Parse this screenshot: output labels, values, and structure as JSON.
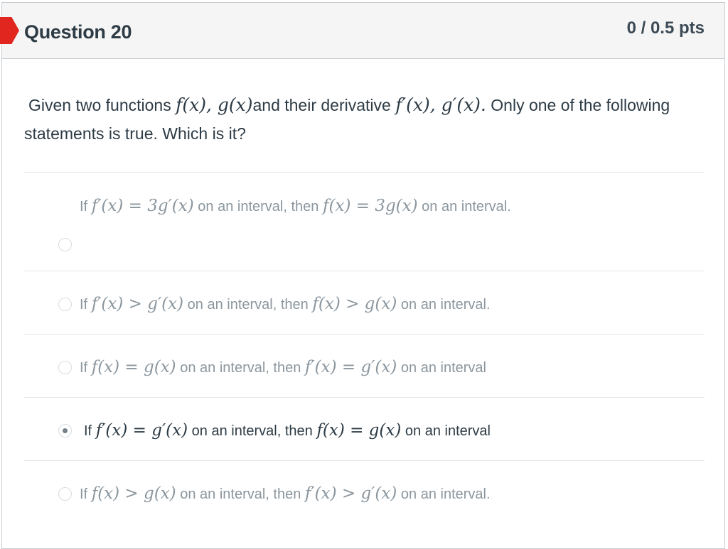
{
  "question": {
    "title": "Question 20",
    "points": "0 / 0.5 pts",
    "text_lead": "Given two functions",
    "text_math1": "f(x), g(x)",
    "text_mid": "and their derivative",
    "text_math2": "f′(x), g′(x).",
    "text_tail": "Only one of the following statements is true. Which is it?"
  },
  "answers": [
    {
      "if": "If",
      "m1": "f′(x) = 3g′(x)",
      "mid": "on an interval, then",
      "m2": "f(x) = 3g(x)",
      "end": "on an interval.",
      "selected": false
    },
    {
      "if": "If",
      "m1": "f′(x) > g′(x)",
      "mid": "on an interval, then",
      "m2": "f(x) > g(x)",
      "end": "on an interval.",
      "selected": false
    },
    {
      "if": "If",
      "m1": "f(x) = g(x)",
      "mid": "on an interval, then",
      "m2": "f′(x) = g′(x)",
      "end": "on an interval",
      "selected": false
    },
    {
      "if": "If",
      "m1": "f′(x) = g′(x)",
      "mid": "on an interval, then",
      "m2": "f(x) = g(x)",
      "end": "on an interval",
      "selected": true
    },
    {
      "if": "If",
      "m1": "f(x) > g(x)",
      "mid": "on an interval, then",
      "m2": "f′(x) > g′(x)",
      "end": "on an interval.",
      "selected": false
    }
  ],
  "colors": {
    "incorrect_flag": "#e0261e",
    "header_bg": "#f5f5f5",
    "text": "#2d3b45",
    "muted_text": "#8b969e"
  }
}
